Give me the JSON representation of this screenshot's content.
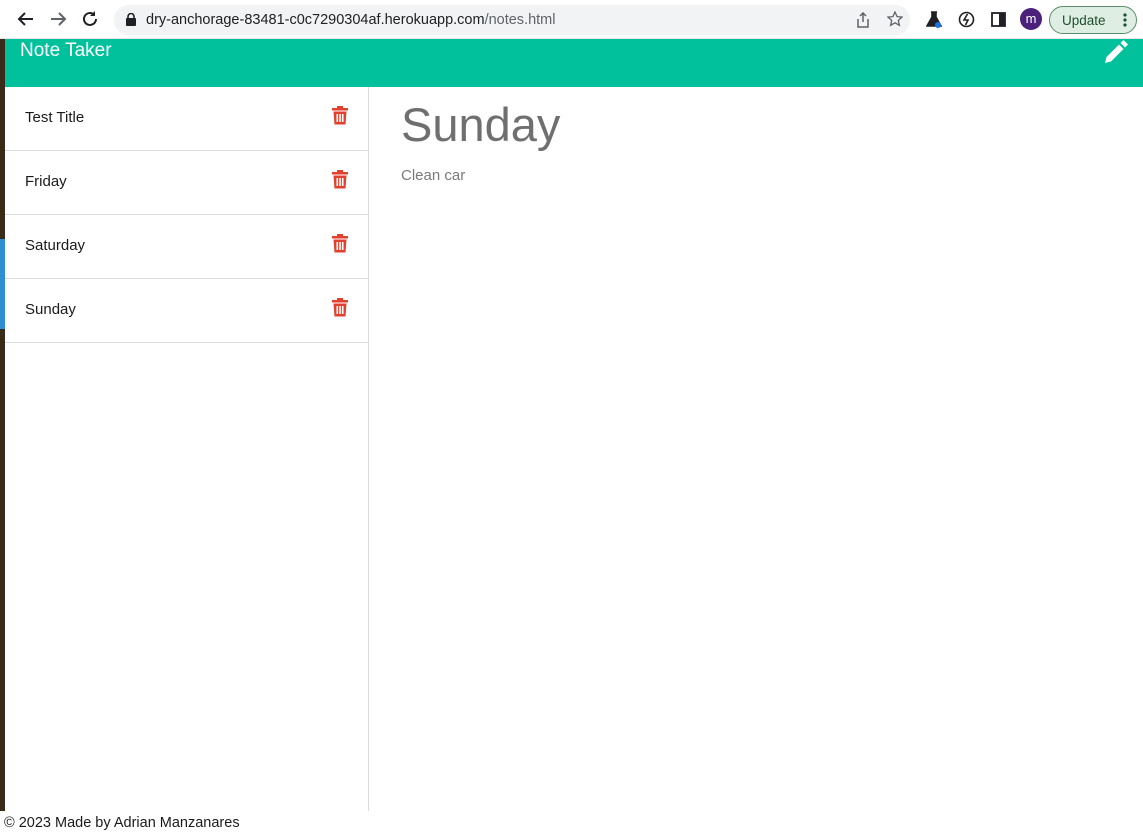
{
  "browser": {
    "url_host": "dry-anchorage-83481-c0c7290304af.herokuapp.com",
    "url_path": "/notes.html",
    "update_label": "Update",
    "profile_initials": "m"
  },
  "app": {
    "title": "Note Taker",
    "accent_color": "#00c19c",
    "delete_color": "#e0402e"
  },
  "notes": [
    {
      "title": "Test Title"
    },
    {
      "title": "Friday"
    },
    {
      "title": "Saturday"
    },
    {
      "title": "Sunday"
    }
  ],
  "active_note": {
    "title": "Sunday",
    "text": "Clean car"
  },
  "footer": {
    "text": "© 2023 Made by Adrian Manzanares"
  }
}
